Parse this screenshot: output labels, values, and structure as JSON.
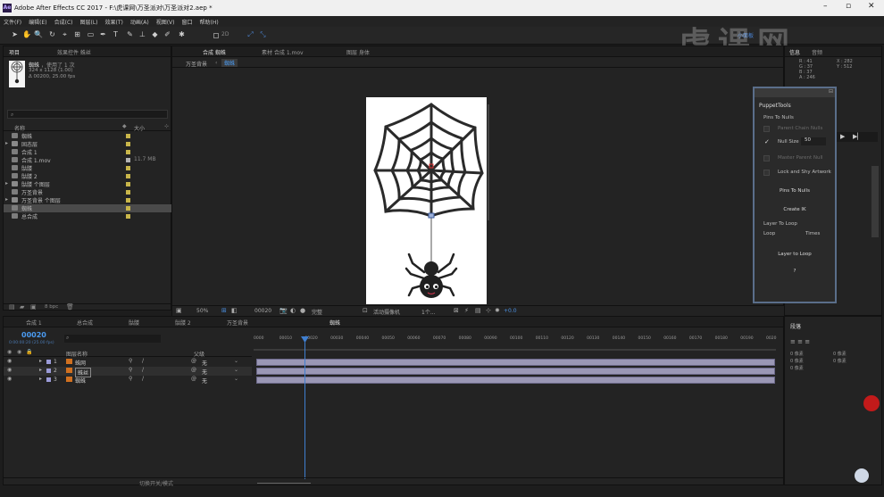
{
  "window": {
    "title": "Adobe After Effects CC 2017 - F:\\虎课网\\万圣派对\\万圣派对2.aep *",
    "logo": "Ae"
  },
  "menus": [
    "文件(F)",
    "编辑(E)",
    "合成(C)",
    "图层(L)",
    "效果(T)",
    "动画(A)",
    "视图(V)",
    "窗口",
    "帮助(H)"
  ],
  "toolbar": {
    "extra_label": "2D",
    "workspace_label": "小面板"
  },
  "watermark": {
    "text": "虎课网"
  },
  "project_panel": {
    "tabs": [
      "项目",
      "效果控件 蛛丝"
    ],
    "selected_name": "蜘蛛",
    "selected_used": "，使用了 1 次",
    "selected_size": "324 x 1128 (1.00)",
    "selected_duration": "Δ 00200, 25.00 fps",
    "search_placeholder": "",
    "col_name": "名称",
    "col_size": "大小",
    "items": [
      {
        "name": "蜘蛛",
        "type": "comp",
        "size": ""
      },
      {
        "name": "固态层",
        "type": "folder",
        "size": ""
      },
      {
        "name": "合成 1",
        "type": "comp",
        "size": ""
      },
      {
        "name": "合成 1.mov",
        "type": "footage",
        "size": "11.7 MB"
      },
      {
        "name": "骷髅",
        "type": "comp",
        "size": ""
      },
      {
        "name": "骷髅 2",
        "type": "comp",
        "size": ""
      },
      {
        "name": "骷髅 个图层",
        "type": "folder",
        "size": ""
      },
      {
        "name": "万圣背景",
        "type": "comp",
        "size": ""
      },
      {
        "name": "万圣背景 个图层",
        "type": "folder",
        "size": ""
      },
      {
        "name": "蜘蛛",
        "type": "comp",
        "size": "",
        "selected": true
      },
      {
        "name": "总合成",
        "type": "comp",
        "size": ""
      }
    ],
    "bpc": "8 bpc"
  },
  "comp_panel": {
    "tabs": [
      "合成 蜘蛛",
      "素材 合成 1.mov",
      "图层 身体"
    ],
    "breadcrumb": [
      "万圣背景",
      "蜘蛛"
    ],
    "zoom": "50%",
    "timecode": "00020",
    "resolution": "完整",
    "camera": "活动摄像机",
    "views": "1个...",
    "exposure": "+0.0"
  },
  "right_panel": {
    "tabs": [
      "信息",
      "音频"
    ],
    "info": [
      "R : 41",
      "G : 37",
      "B : 37",
      "A : 246",
      "X : 282",
      "Y : 512"
    ],
    "paragraph_tab": "段落"
  },
  "puppet_tools": {
    "title": "PuppetTools",
    "section1": "Pins To Nulls",
    "opt_parent": "Parent Chain Nulls",
    "opt_nullsize": "Null Size",
    "nullsize_value": "50",
    "opt_master": "Master Parent Null",
    "opt_lock": "Lock and Shy Artwork",
    "btn_pins": "Pins To Nulls",
    "btn_create": "Create IK",
    "section2": "Layer To Loop",
    "loop_label": "Loop",
    "times_label": "Times",
    "btn_layer_loop": "Layer to Loop",
    "btn_help": "?"
  },
  "timeline": {
    "tabs": [
      "合成 1",
      "总合成",
      "骷髅",
      "骷髅 2",
      "万圣背景",
      "蜘蛛"
    ],
    "timecode": "00020",
    "timecode_sub": "0:00:00:20 (25.00 fps)",
    "col_layer": "图层名称",
    "col_parent": "父级",
    "layers": [
      {
        "num": "1",
        "name": "蛛网",
        "parent": "无"
      },
      {
        "num": "2",
        "name": "蛛丝",
        "parent": "无"
      },
      {
        "num": "3",
        "name": "蜘蛛",
        "parent": "无"
      }
    ],
    "ruler": [
      "0000",
      "00010",
      "00020",
      "00030",
      "00040",
      "00050",
      "00060",
      "00070",
      "00080",
      "00090",
      "00100",
      "00110",
      "00120",
      "00130",
      "00140",
      "00150",
      "00160",
      "00170",
      "00180",
      "00190",
      "0020"
    ],
    "footer_toggle": "切换开关/模式"
  },
  "paragraph_panel": {
    "values": [
      "0 像素",
      "0 像素",
      "0 像素",
      "0 像素",
      "0 像素"
    ]
  }
}
